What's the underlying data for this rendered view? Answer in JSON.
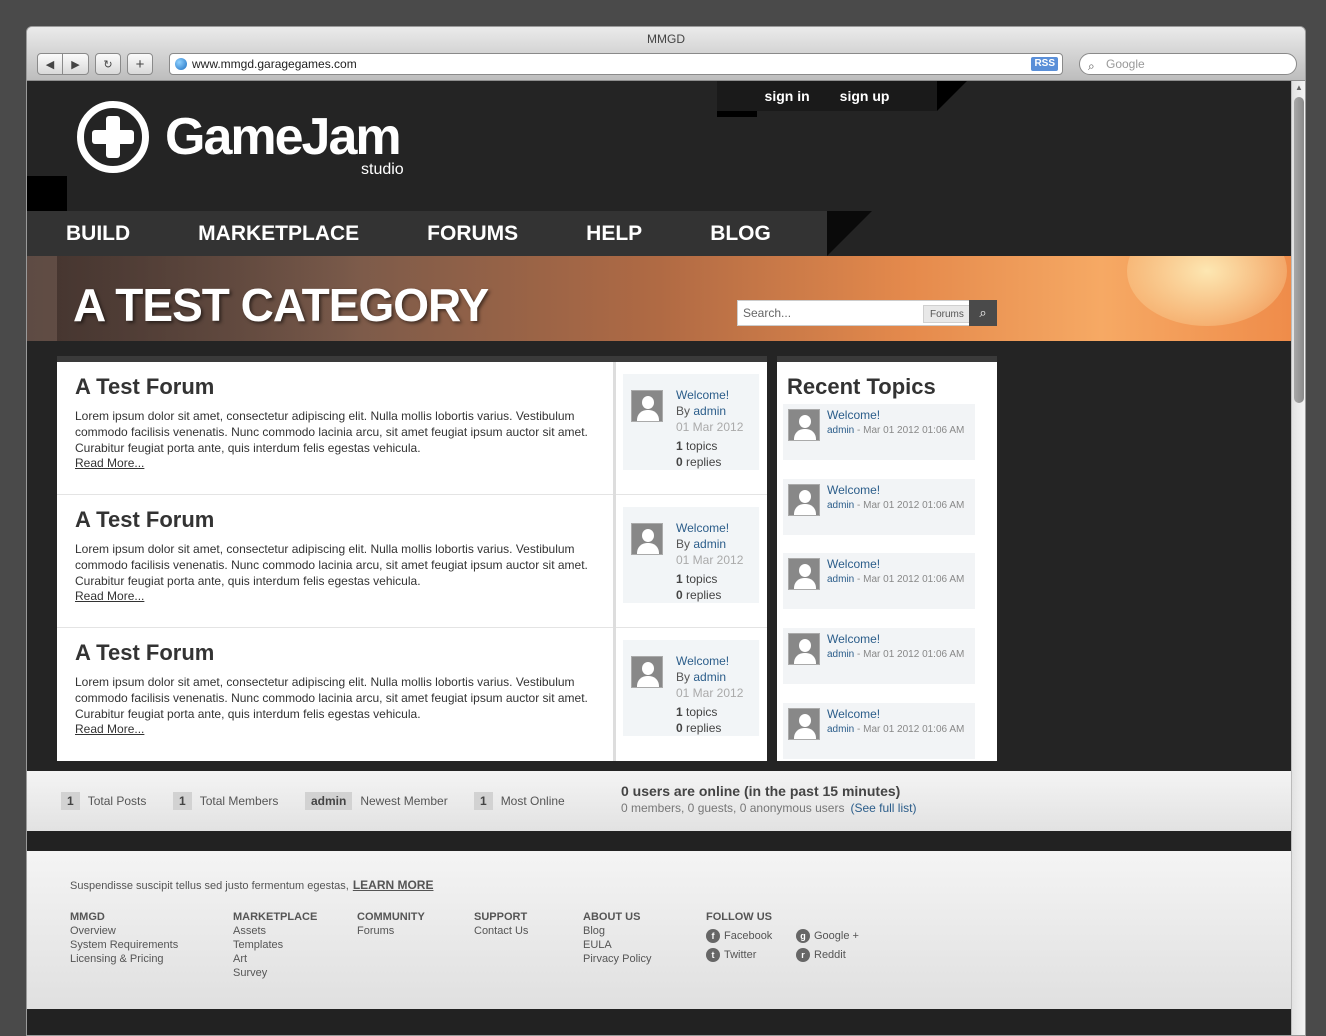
{
  "browser": {
    "title": "MMGD",
    "url": "www.mmgd.garagegames.com",
    "rss": "RSS",
    "search_placeholder": "Google",
    "back_icon": "◀",
    "forward_icon": "▶",
    "reload_icon": "↻",
    "add_icon": "+"
  },
  "header": {
    "logo_text": "GameJam",
    "logo_sub": "studio",
    "sign_in": "sign in",
    "sign_up": "sign up"
  },
  "nav": [
    "BUILD",
    "MARKETPLACE",
    "FORUMS",
    "HELP",
    "BLOG"
  ],
  "banner": {
    "title": "A TEST CATEGORY",
    "search_placeholder": "Search...",
    "search_scope": "Forums",
    "search_icon": "🔍"
  },
  "forums": [
    {
      "title": "A Test Forum",
      "description": "Lorem ipsum dolor sit amet, consectetur adipiscing elit. Nulla mollis lobortis varius. Vestibulum commodo facilisis venenatis. Nunc commodo lacinia arcu, sit amet feugiat ipsum auctor sit amet. Curabitur feugiat porta ante, quis interdum felis egestas vehicula.",
      "read_more": "Read More...",
      "last_topic": "Welcome!",
      "by_label": "By",
      "by_user": "admin",
      "date": "01 Mar 2012",
      "topics_count": "1",
      "topics_label": "topics",
      "replies_count": "0",
      "replies_label": "replies"
    },
    {
      "title": "A Test Forum",
      "description": "Lorem ipsum dolor sit amet, consectetur adipiscing elit. Nulla mollis lobortis varius. Vestibulum commodo facilisis venenatis. Nunc commodo lacinia arcu, sit amet feugiat ipsum auctor sit amet. Curabitur feugiat porta ante, quis interdum felis egestas vehicula.",
      "read_more": "Read More...",
      "last_topic": "Welcome!",
      "by_label": "By",
      "by_user": "admin",
      "date": "01 Mar 2012",
      "topics_count": "1",
      "topics_label": "topics",
      "replies_count": "0",
      "replies_label": "replies"
    },
    {
      "title": "A Test Forum",
      "description": "Lorem ipsum dolor sit amet, consectetur adipiscing elit. Nulla mollis lobortis varius. Vestibulum commodo facilisis venenatis. Nunc commodo lacinia arcu, sit amet feugiat ipsum auctor sit amet. Curabitur feugiat porta ante, quis interdum felis egestas vehicula.",
      "read_more": "Read More...",
      "last_topic": "Welcome!",
      "by_label": "By",
      "by_user": "admin",
      "date": "01 Mar 2012",
      "topics_count": "1",
      "topics_label": "topics",
      "replies_count": "0",
      "replies_label": "replies"
    }
  ],
  "recent": {
    "title": "Recent Topics",
    "items": [
      {
        "topic": "Welcome!",
        "user": "admin",
        "meta": " - Mar 01 2012 01:06 AM"
      },
      {
        "topic": "Welcome!",
        "user": "admin",
        "meta": " - Mar 01 2012 01:06 AM"
      },
      {
        "topic": "Welcome!",
        "user": "admin",
        "meta": " - Mar 01 2012 01:06 AM"
      },
      {
        "topic": "Welcome!",
        "user": "admin",
        "meta": " - Mar 01 2012 01:06 AM"
      },
      {
        "topic": "Welcome!",
        "user": "admin",
        "meta": " - Mar 01 2012 01:06 AM"
      }
    ]
  },
  "stats": {
    "total_posts_value": "1",
    "total_posts_label": "Total Posts",
    "total_members_value": "1",
    "total_members_label": "Total Members",
    "newest_member_value": "admin",
    "newest_member_label": "Newest Member",
    "most_online_value": "1",
    "most_online_label": "Most Online",
    "online_headline": "0 users are online (in the past 15 minutes)",
    "online_detail": "0 members, 0 guests, 0 anonymous users",
    "full_list": "(See full list)"
  },
  "footer": {
    "lead": "Suspendisse suscipit tellus sed justo fermentum egestas,",
    "learn_more": "LEARN MORE",
    "columns": [
      {
        "heading": "MMGD",
        "links": [
          "Overview",
          "System Requirements",
          "Licensing & Pricing"
        ]
      },
      {
        "heading": "MARKETPLACE",
        "links": [
          "Assets",
          "Templates",
          "Art",
          "Survey"
        ]
      },
      {
        "heading": "COMMUNITY",
        "links": [
          "Forums"
        ]
      },
      {
        "heading": "SUPPORT",
        "links": [
          "Contact Us"
        ]
      },
      {
        "heading": "ABOUT US",
        "links": [
          "Blog",
          "EULA",
          "Pirvacy Policy"
        ]
      }
    ],
    "follow_heading": "FOLLOW US",
    "social": [
      "Facebook",
      "Twitter",
      "Google +",
      "Reddit"
    ]
  }
}
